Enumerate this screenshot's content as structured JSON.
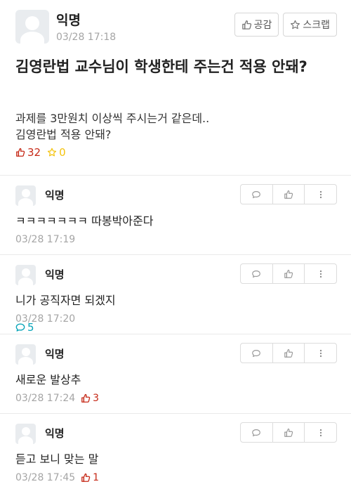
{
  "post": {
    "author": "익명",
    "time": "03/28 17:18",
    "empathy_label": "공감",
    "scrap_label": "스크랩",
    "title": "김영란법 교수님이 학생한테 주는건 적용 안돼?",
    "body": "과제를 3만원치 이상씩 주시는거 같은데..\n김영란법 적용 안돼?",
    "stats": {
      "likes": "32",
      "comments": "5",
      "scraps": "0"
    },
    "icons": {
      "like": "thumbs-up-icon",
      "comment": "speech-bubble-icon",
      "scrap": "star-icon"
    },
    "colors": {
      "likes": "#c62917",
      "comments": "#07a4b8",
      "scraps": "#f4c30d"
    }
  },
  "comments": [
    {
      "author": "익명",
      "text": "ㅋㅋㅋㅋㅋㅋㅋ 따봉박아준다",
      "time": "03/28 17:19",
      "likes": ""
    },
    {
      "author": "익명",
      "text": "니가 공직자면 되겠지",
      "time": "03/28 17:20",
      "likes": ""
    },
    {
      "author": "익명",
      "text": "새로운 발상추",
      "time": "03/28 17:24",
      "likes": "3"
    },
    {
      "author": "익명",
      "text": "듣고 보니 맞는 말",
      "time": "03/28 17:45",
      "likes": "1"
    }
  ]
}
